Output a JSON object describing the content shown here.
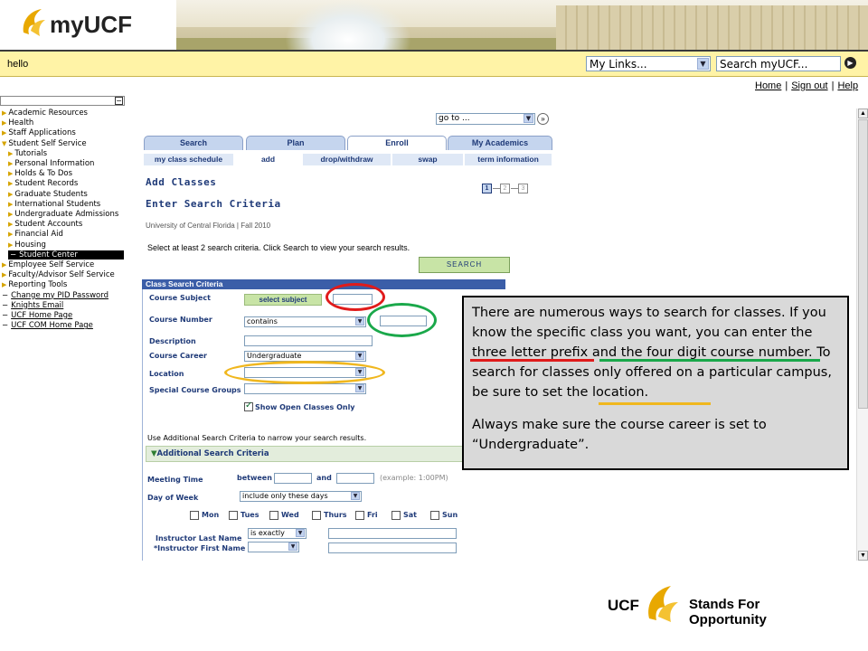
{
  "header": {
    "logo_text": "myUCF",
    "greeting": "hello"
  },
  "topbar": {
    "my_links": "My Links...",
    "search_placeholder": "Search myUCF..."
  },
  "toplinks": [
    "Home",
    "Sign out",
    "Help"
  ],
  "sidebar": {
    "items": [
      {
        "label": "Academic Resources",
        "type": "tri"
      },
      {
        "label": "Health",
        "type": "tri"
      },
      {
        "label": "Staff Applications",
        "type": "tri"
      },
      {
        "label": "Student Self Service",
        "type": "tri-open"
      },
      {
        "label": "Tutorials",
        "type": "sub"
      },
      {
        "label": "Personal Information",
        "type": "sub"
      },
      {
        "label": "Holds & To Dos",
        "type": "sub"
      },
      {
        "label": "Student Records",
        "type": "sub"
      },
      {
        "label": "Graduate Students",
        "type": "sub"
      },
      {
        "label": "International Students",
        "type": "sub"
      },
      {
        "label": "Undergraduate Admissions",
        "type": "sub"
      },
      {
        "label": "Student Accounts",
        "type": "sub"
      },
      {
        "label": "Financial Aid",
        "type": "sub"
      },
      {
        "label": "Housing",
        "type": "sub"
      },
      {
        "label": "Student Center",
        "type": "current"
      },
      {
        "label": "Employee Self Service",
        "type": "tri"
      },
      {
        "label": "Faculty/Advisor Self Service",
        "type": "tri"
      },
      {
        "label": "Reporting Tools",
        "type": "tri"
      },
      {
        "label": "Change my PID Password",
        "type": "link"
      },
      {
        "label": "Knights Email",
        "type": "link"
      },
      {
        "label": "UCF Home Page",
        "type": "link"
      },
      {
        "label": "UCF COM Home Page",
        "type": "link"
      }
    ]
  },
  "nav": {
    "goto": "go to ...",
    "tabs": [
      "Search",
      "Plan",
      "Enroll",
      "My Academics"
    ],
    "active_tab": "Enroll",
    "subtabs": [
      "my class schedule",
      "add",
      "drop/withdraw",
      "swap",
      "term information"
    ],
    "active_subtab": "add"
  },
  "page": {
    "title": "Add Classes",
    "subtitle": "Enter Search Criteria",
    "steps": [
      "1",
      "2",
      "3"
    ],
    "term": "University of Central Florida | Fall 2010",
    "instructions": "Select at least 2 search criteria. Click Search to view your search results.",
    "search_button": "Search"
  },
  "criteria": {
    "header": "Class Search Criteria",
    "course_subject": "Course Subject",
    "select_subject": "select subject",
    "course_number": "Course Number",
    "course_number_op": "contains",
    "description": "Description",
    "course_career": "Course Career",
    "course_career_value": "Undergraduate",
    "location": "Location",
    "special_groups": "Special Course Groups",
    "open_only": "Show Open Classes Only",
    "additional_note": "Use Additional Search Criteria to narrow your search results.",
    "additional_header": "Additional Search Criteria",
    "meeting_time": "Meeting Time",
    "between": "between",
    "and": "and",
    "example": "(example: 1:00PM)",
    "day_of_week": "Day of Week",
    "days_op": "include only these days",
    "days": [
      "Mon",
      "Tues",
      "Wed",
      "Thurs",
      "Fri",
      "Sat",
      "Sun"
    ],
    "instructor_last": "Instructor Last Name",
    "instructor_last_op": "is exactly",
    "instructor_first": "*Instructor First Name"
  },
  "callout": {
    "p1": "There are numerous ways to search for classes. If you know the specific class you want, you can enter the three letter prefix and the four digit course number. To search for classes only offered on a particular campus, be sure to set the location.",
    "p2": "Always make sure the course career is set to “Undergraduate”."
  },
  "footer": {
    "ucf": "UCF",
    "tagline": "Stands For Opportunity"
  },
  "colors": {
    "red": "#e01b1b",
    "green": "#1aa84a",
    "gold": "#f0b71e",
    "accent": "#1f3a78"
  }
}
